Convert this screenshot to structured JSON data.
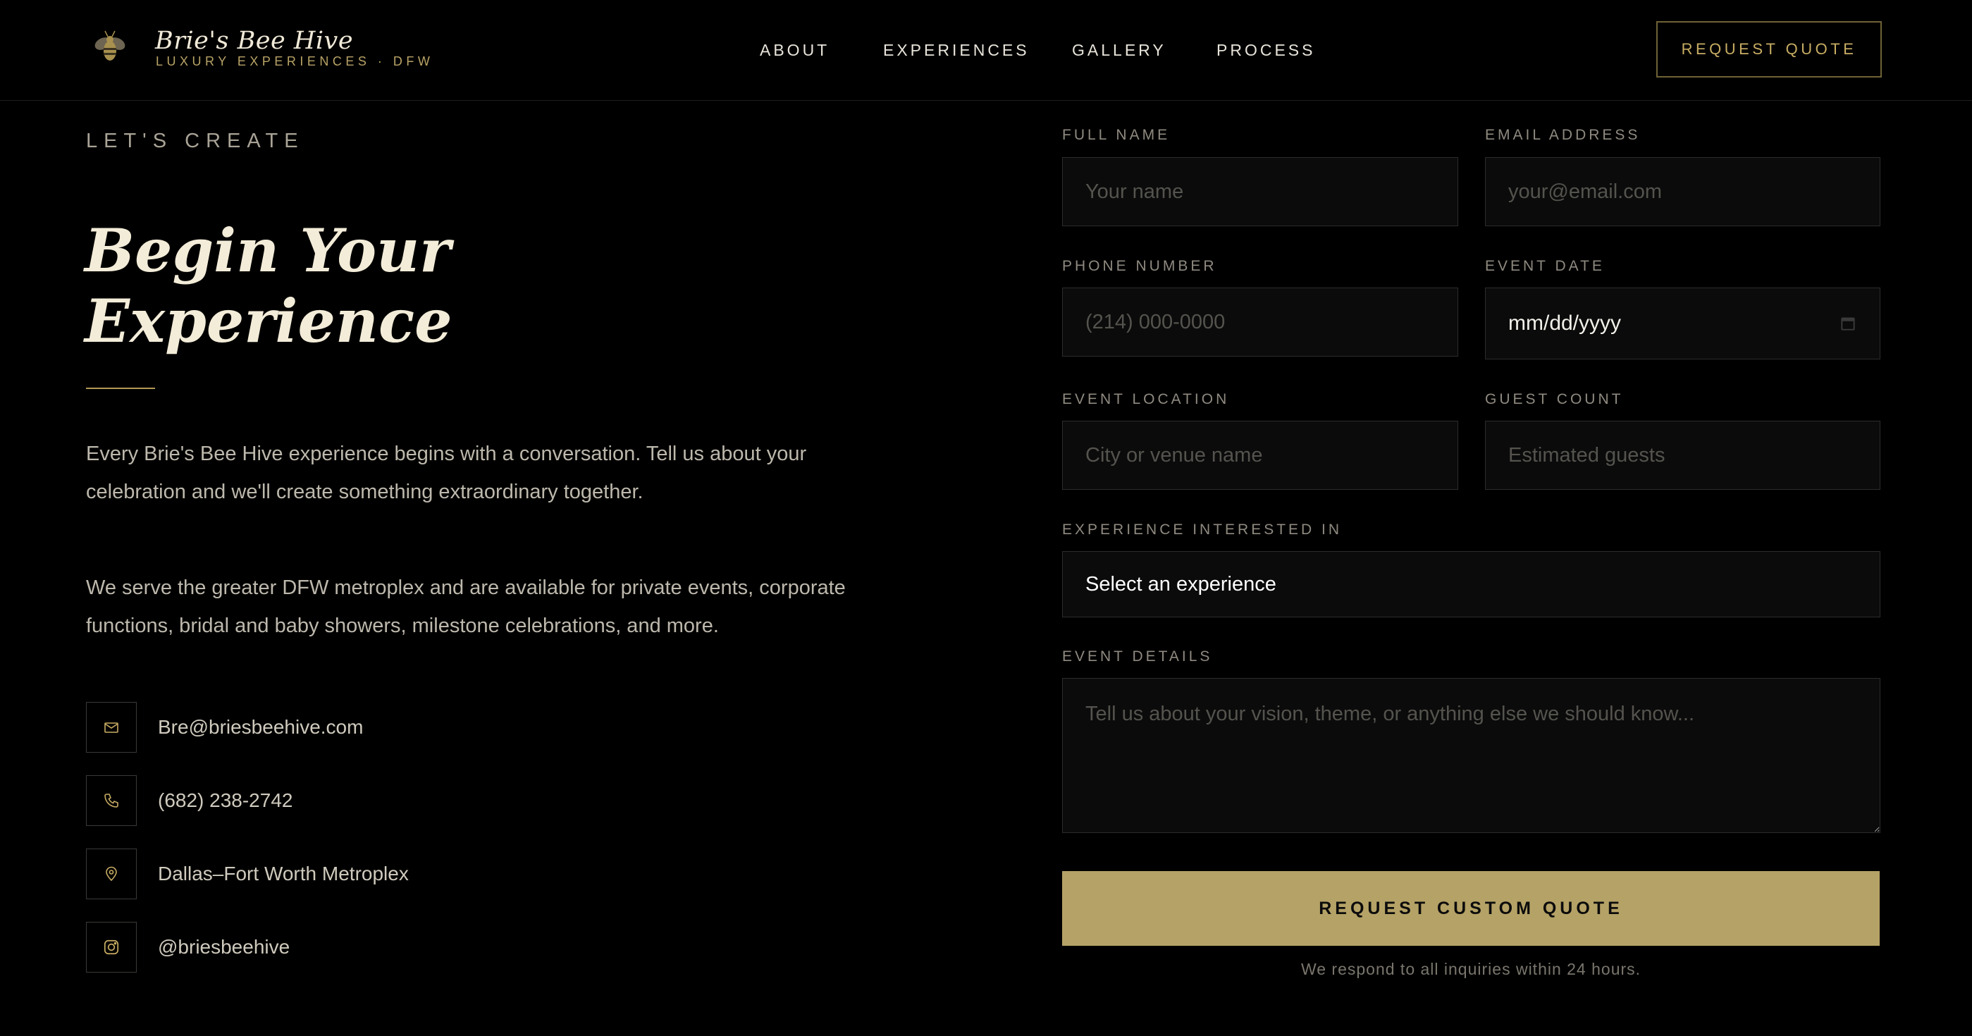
{
  "brand": {
    "name": "Brie's Bee Hive",
    "tagline": "LUXURY EXPERIENCES · DFW",
    "logo_icon": "bee-icon"
  },
  "nav": {
    "items": [
      {
        "label": "ABOUT"
      },
      {
        "label": "EXPERIENCES"
      },
      {
        "label": "GALLERY"
      },
      {
        "label": "PROCESS"
      }
    ],
    "cta_label": "REQUEST QUOTE"
  },
  "hero": {
    "eyebrow": "LET'S CREATE",
    "title_line1": "Begin Your",
    "title_line2": "Experience",
    "paragraph1": "Every Brie's Bee Hive experience begins with a conversation. Tell us about your celebration and we'll create something extraordinary together.",
    "paragraph2": "We serve the greater DFW metroplex and are available for private events, corporate functions, bridal and baby showers, milestone celebrations, and more."
  },
  "contacts": [
    {
      "icon": "mail-icon",
      "text": "Bre@briesbeehive.com"
    },
    {
      "icon": "phone-icon",
      "text": "(682) 238-2742"
    },
    {
      "icon": "map-pin-icon",
      "text": "Dallas–Fort Worth Metroplex"
    },
    {
      "icon": "instagram-icon",
      "text": "@briesbeehive"
    }
  ],
  "form": {
    "full_name": {
      "label": "FULL NAME",
      "placeholder": "Your name"
    },
    "email": {
      "label": "EMAIL ADDRESS",
      "placeholder": "your@email.com"
    },
    "phone": {
      "label": "PHONE NUMBER",
      "placeholder": "(214) 000-0000"
    },
    "event_date": {
      "label": "EVENT DATE",
      "value": "mm/dd/yyyy",
      "icon": "calendar-icon"
    },
    "location": {
      "label": "EVENT LOCATION",
      "placeholder": "City or venue name"
    },
    "guests": {
      "label": "GUEST COUNT",
      "placeholder": "Estimated guests"
    },
    "experience": {
      "label": "EXPERIENCE INTERESTED IN",
      "selected": "Select an experience"
    },
    "details": {
      "label": "EVENT DETAILS",
      "placeholder": "Tell us about your vision, theme, or anything else we should know..."
    },
    "submit_label": "REQUEST CUSTOM QUOTE",
    "footnote": "We respond to all inquiries within 24 hours."
  },
  "colors": {
    "background": "#000000",
    "gold": "#b5a266",
    "cream": "#f3ecd8"
  }
}
